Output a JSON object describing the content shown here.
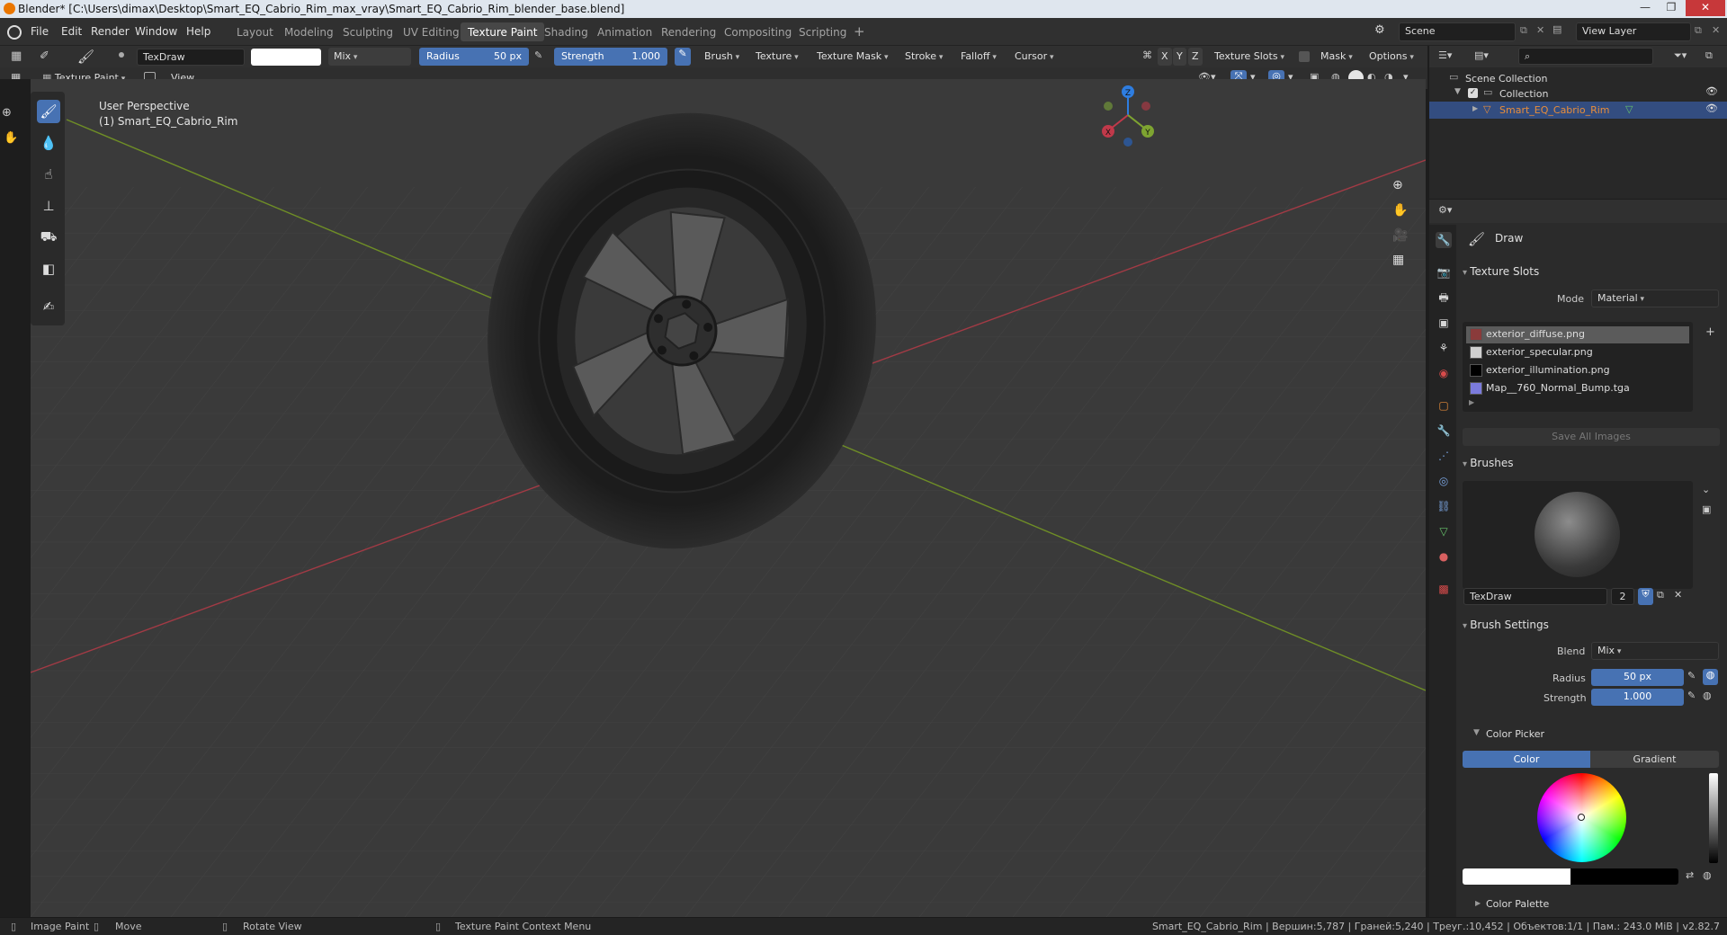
{
  "window": {
    "title": "Blender* [C:\\Users\\dimax\\Desktop\\Smart_EQ_Cabrio_Rim_max_vray\\Smart_EQ_Cabrio_Rim_blender_base.blend]",
    "minimize": "—",
    "maximize": "❐",
    "close": "✕"
  },
  "menu": {
    "items": [
      "File",
      "Edit",
      "Render",
      "Window",
      "Help"
    ],
    "workspaces": [
      "Layout",
      "Modeling",
      "Sculpting",
      "UV Editing",
      "Texture Paint",
      "Shading",
      "Animation",
      "Rendering",
      "Compositing",
      "Scripting"
    ],
    "add_tab": "+",
    "scene": "Scene",
    "view_layer": "View Layer"
  },
  "tool_header": {
    "brush_name": "TexDraw",
    "blend": "Mix",
    "radius_label": "Radius",
    "radius_value": "50 px",
    "strength_label": "Strength",
    "strength_value": "1.000",
    "menus": [
      "Brush",
      "Texture",
      "Texture Mask",
      "Stroke",
      "Falloff",
      "Cursor"
    ],
    "axes": [
      "X",
      "Y",
      "Z"
    ],
    "texture_slots": "Texture Slots",
    "mask": "Mask",
    "options": "Options"
  },
  "viewport_header": {
    "mode": "Texture Paint",
    "view": "View"
  },
  "viewport": {
    "perspective": "User Perspective",
    "object": "(1) Smart_EQ_Cabrio_Rim",
    "gizmo": {
      "x": "X",
      "y": "Y",
      "z": "Z"
    }
  },
  "outliner": {
    "scene_collection": "Scene Collection",
    "collection": "Collection",
    "object": "Smart_EQ_Cabrio_Rim"
  },
  "properties": {
    "tool_name": "Draw",
    "texture_slots": {
      "title": "Texture Slots",
      "mode_label": "Mode",
      "mode_value": "Material",
      "slots": [
        "exterior_diffuse.png",
        "exterior_specular.png",
        "exterior_illumination.png",
        "Map__760_Normal_Bump.tga"
      ],
      "slot_colors": [
        "#8a3b3b",
        "#d0d0d0",
        "#000000",
        "#7b7bdc"
      ],
      "save_all": "Save All Images"
    },
    "brushes": {
      "title": "Brushes",
      "name": "TexDraw",
      "users": "2"
    },
    "brush_settings": {
      "title": "Brush Settings",
      "blend_label": "Blend",
      "blend_value": "Mix",
      "radius_label": "Radius",
      "radius_value": "50 px",
      "strength_label": "Strength",
      "strength_value": "1.000",
      "color_picker": "Color Picker",
      "color_tab": "Color",
      "gradient_tab": "Gradient",
      "color_palette": "Color Palette"
    }
  },
  "statusbar": {
    "image_paint": "Image Paint",
    "move": "Move",
    "rotate_view": "Rotate View",
    "context_menu": "Texture Paint Context Menu",
    "stats": "Smart_EQ_Cabrio_Rim | Вершин:5,787 | Граней:5,240 | Треуг.:10,452 | Объектов:1/1 | Пам.: 243.0 MiB | v2.82.7"
  },
  "colors": {
    "accent": "#4772b3",
    "x_axis": "#c0394a",
    "y_axis": "#7ea431",
    "z_axis": "#2e7de0"
  }
}
